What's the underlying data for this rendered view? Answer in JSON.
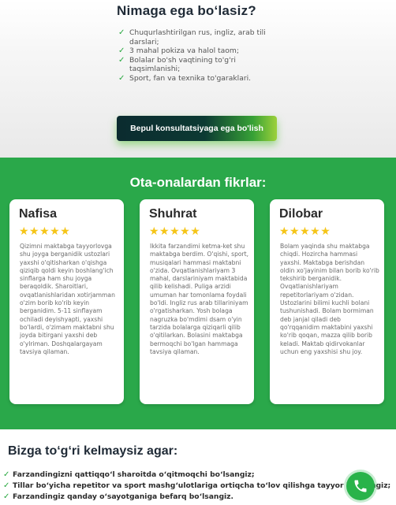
{
  "why": {
    "title": "Nimaga ega bo‘lasiz?",
    "items": [
      "Chuqurlashtirilgan rus, ingliz, arab tili darslari;",
      "3 mahal pokiza va halol taom;",
      "Bolalar bo'sh vaqtining to'g'ri taqsimlanishi;",
      "Sport, fan va texnika to'garaklari."
    ],
    "check_icon": "✓",
    "cta_label": "Bepul konsultatsiyaga ega bo'lish"
  },
  "reviews": {
    "title": "Ota-onalardan fikrlar:",
    "stars": "★★★★★",
    "star_color": "#f5c518",
    "background": "#2aa84a",
    "cards": [
      {
        "name": "Nafisa",
        "rating": 5,
        "text": "Qizimni maktabga tayyorlovga shu joyga berganidik ustozlari yaxshi o'qitisharkan o'qishga qiziqib qoldi keyin boshlang'ich sinflarga ham shu joyga beraqoldik. Sharoitlari, ovqatlanishlaridan xotirjamman o'zim borib ko'rib keyin berganidim. 5-11 sinflayam ochiladi deyishyapti, yaxshi bo'lardi, o'zimam maktabni shu joyda bitirgani yaxshi deb o'ylriman. Doshqalargayam tavsiya qilaman."
      },
      {
        "name": "Shuhrat",
        "rating": 5,
        "text": "Ikkita farzandimi ketma-ket shu maktabga berdim. O'qishi, sport, musiqalari hammasi maktabni o'zida. Ovqatlanishlariyam 3 mahal, darslariniyam maktabida qilib kelishadi. Puliga arzidi umuman har tomonlama foydali bo'ldi. Ingliz rus arab tillariniyam o'rgatisharkan. Yosh bolaga nagruzka bo'mdimi dsam o'yin tarzida bolalarga qiziqarli qilib o'qitilarkan. Bolasini maktabga bermoqchi bo'lgan hammaga tavsiya qilaman."
      },
      {
        "name": "Dilobar",
        "rating": 5,
        "text": "Bolam yaqinda shu maktabga chiqdi. Hozircha hammasi yaxshi. Maktabga berishdan oldin xo'jayinim bilan borib ko'rib tekshirib berganidik. Ovqatlanishlariyam repetitorlariyam o'zidan. Ustozlarini bilimi kuchli bolani tushunishadi. Bolam bormiman deb janjal qiladi deb qo'rqqanidim maktabini yaxshi ko'rib qoqan, mazza qilib borib keladi. Maktab qidirvokanlar uchun eng yaxshisi shu joy."
      }
    ]
  },
  "warning": {
    "title": "Bizga to‘g‘ri kelmaysiz agar:",
    "items": [
      "Farzandingizni qattiqqo‘l sharoitda o‘qitmoqchi bo‘lsangiz;",
      "Tillar bo‘yicha repetitor va sport mashg‘ulotlariga ortiqcha to‘lov qilishga tayyor bo‘lsangiz;",
      "Farzandingiz qanday o‘sayotganiga befarq bo‘lsangiz."
    ]
  },
  "phone_icon": "phone-icon"
}
